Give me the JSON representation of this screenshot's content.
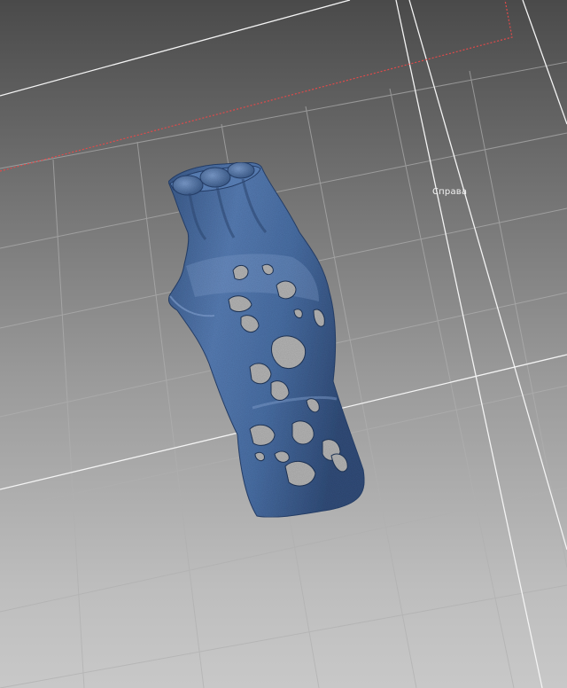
{
  "viewport": {
    "view_label": "Справа",
    "background_colors": {
      "top": "#4a4a4a",
      "bottom": "#c8c8c8",
      "grid_minor": "#b5b5b5",
      "grid_major": "#ffffff",
      "bounds_line": "#e04a4a"
    },
    "model": {
      "name": "perforated-forearm-splint",
      "color": "#4f73a8",
      "highlight_color": "#86a6d8",
      "shadow_color": "#2d4468",
      "hole_color": "#b8b8b8"
    }
  }
}
